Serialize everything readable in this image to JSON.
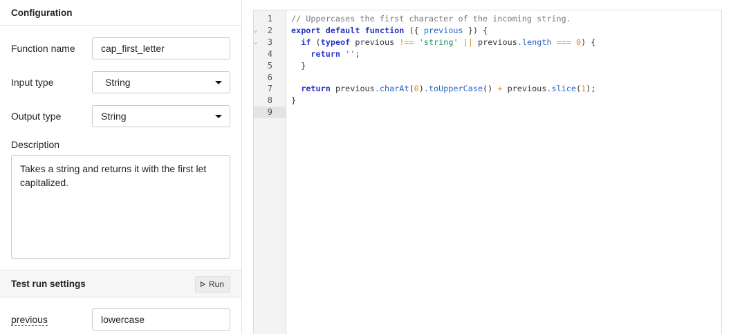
{
  "config": {
    "title": "Configuration",
    "function_name_label": "Function name",
    "function_name_value": "cap_first_letter",
    "input_type_label": "Input type",
    "input_type_value": "String",
    "output_type_label": "Output type",
    "output_type_value": "String",
    "description_label": "Description",
    "description_value": "Takes a string and returns it with the first let\ncapitalized."
  },
  "test_run": {
    "title": "Test run settings",
    "run_label": "Run",
    "param_label": "previous",
    "param_value": "lowercase"
  },
  "editor": {
    "line_numbers": [
      "1",
      "2",
      "3",
      "4",
      "5",
      "6",
      "7",
      "8",
      "9"
    ],
    "fold_markers": {
      "2": "chevron-down",
      "3": "chevron-down"
    },
    "active_line": "9",
    "code_lines": [
      [
        {
          "t": "// Uppercases the first character of the incoming string.",
          "c": "comment"
        }
      ],
      [
        {
          "t": "export",
          "c": "kw"
        },
        {
          "t": " ",
          "c": "plain"
        },
        {
          "t": "default",
          "c": "kw"
        },
        {
          "t": " ",
          "c": "plain"
        },
        {
          "t": "function",
          "c": "kw"
        },
        {
          "t": " ({ ",
          "c": "plain"
        },
        {
          "t": "previous",
          "c": "param"
        },
        {
          "t": " }) {",
          "c": "plain"
        }
      ],
      [
        {
          "t": "  ",
          "c": "plain"
        },
        {
          "t": "if",
          "c": "kw"
        },
        {
          "t": " (",
          "c": "plain"
        },
        {
          "t": "typeof",
          "c": "kw"
        },
        {
          "t": " previous ",
          "c": "plain"
        },
        {
          "t": "!==",
          "c": "op"
        },
        {
          "t": " ",
          "c": "plain"
        },
        {
          "t": "'string'",
          "c": "str"
        },
        {
          "t": " ",
          "c": "plain"
        },
        {
          "t": "||",
          "c": "op"
        },
        {
          "t": " previous",
          "c": "plain"
        },
        {
          "t": ".length",
          "c": "prop"
        },
        {
          "t": " ",
          "c": "plain"
        },
        {
          "t": "===",
          "c": "op"
        },
        {
          "t": " ",
          "c": "plain"
        },
        {
          "t": "0",
          "c": "num"
        },
        {
          "t": ") {",
          "c": "plain"
        }
      ],
      [
        {
          "t": "    ",
          "c": "plain"
        },
        {
          "t": "return",
          "c": "kw"
        },
        {
          "t": " ",
          "c": "plain"
        },
        {
          "t": "''",
          "c": "str"
        },
        {
          "t": ";",
          "c": "plain"
        }
      ],
      [
        {
          "t": "  }",
          "c": "plain"
        }
      ],
      [
        {
          "t": "",
          "c": "plain"
        }
      ],
      [
        {
          "t": "  ",
          "c": "plain"
        },
        {
          "t": "return",
          "c": "kw"
        },
        {
          "t": " previous",
          "c": "plain"
        },
        {
          "t": ".charAt",
          "c": "prop"
        },
        {
          "t": "(",
          "c": "plain"
        },
        {
          "t": "0",
          "c": "num"
        },
        {
          "t": ")",
          "c": "plain"
        },
        {
          "t": ".toUpperCase",
          "c": "prop"
        },
        {
          "t": "() ",
          "c": "plain"
        },
        {
          "t": "+",
          "c": "op"
        },
        {
          "t": " previous",
          "c": "plain"
        },
        {
          "t": ".slice",
          "c": "prop"
        },
        {
          "t": "(",
          "c": "plain"
        },
        {
          "t": "1",
          "c": "num"
        },
        {
          "t": ");",
          "c": "plain"
        }
      ],
      [
        {
          "t": "}",
          "c": "plain"
        }
      ],
      [
        {
          "t": "",
          "c": "plain"
        }
      ]
    ]
  }
}
